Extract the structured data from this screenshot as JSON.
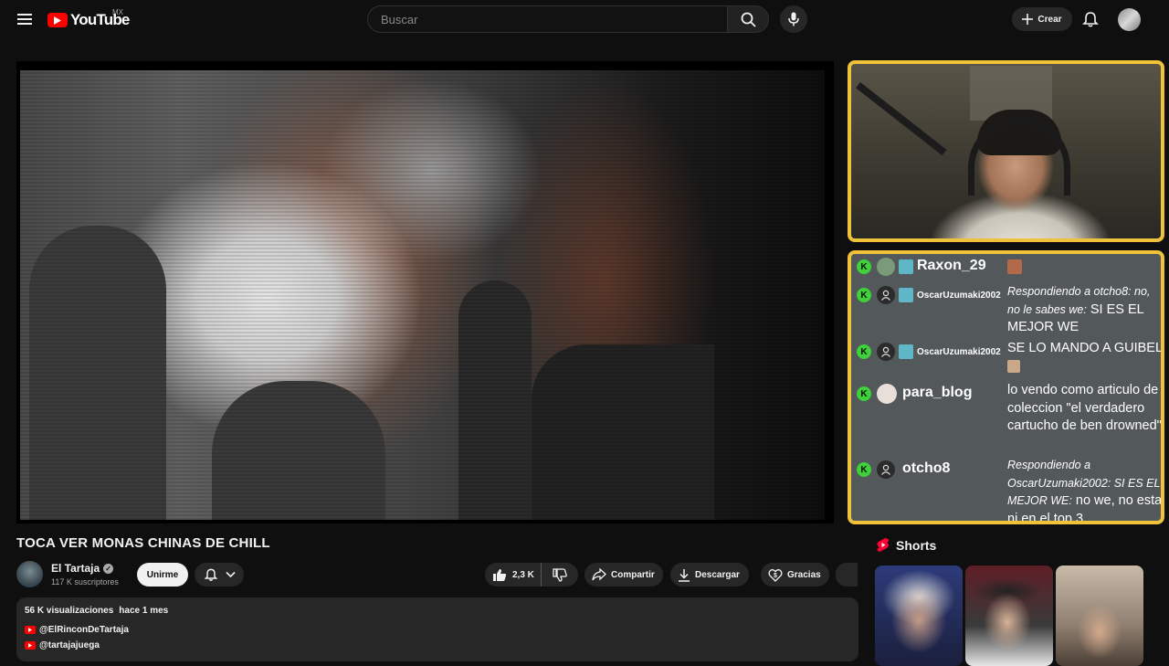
{
  "header": {
    "logo_text": "YouTube",
    "country_code": "MX",
    "search_placeholder": "Buscar",
    "create_label": "Crear"
  },
  "video": {
    "title": "TOCA VER MONAS CHINAS DE CHILL",
    "channel_name": "El Tartaja",
    "subscribers": "117 K suscriptores",
    "join_label": "Unirme",
    "likes": "2,3 K",
    "share_label": "Compartir",
    "download_label": "Descargar",
    "thanks_label": "Gracias"
  },
  "description": {
    "views": "56 K visualizaciones",
    "date": "hace 1 mes",
    "links": [
      "@ElRinconDeTartaja",
      "@tartajajuega"
    ]
  },
  "chat": {
    "messages": [
      {
        "user": "Raxon_29",
        "text": ""
      },
      {
        "user": "OscarUzumaki2002",
        "reply": "Respondiendo a otcho8: no, no le sabes we:",
        "text": "SI ES EL MEJOR WE"
      },
      {
        "user": "OscarUzumaki2002",
        "text": "SE LO MANDO A GUIBEL"
      },
      {
        "user": "para_blog",
        "text": "lo vendo como articulo de coleccion \"el verdadero cartucho de ben drowned\""
      },
      {
        "user": "otcho8",
        "reply": "Respondiendo a OscarUzumaki2002: SI ES EL MEJOR WE:",
        "text": "no we, no esta ni en el top 3"
      }
    ]
  },
  "shorts": {
    "heading": "Shorts"
  },
  "colors": {
    "accent": "#ff0000",
    "chat_border": "#f0c23a",
    "kick_green": "#3ed13a",
    "background": "#0f0f0f"
  }
}
